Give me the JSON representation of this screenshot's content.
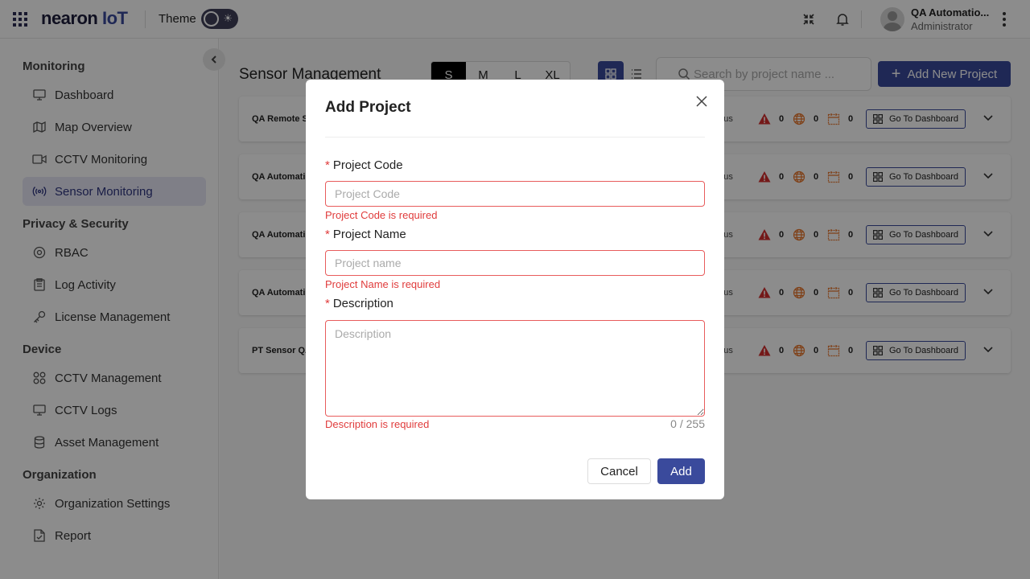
{
  "header": {
    "logo_main": "nearon",
    "logo_iot": "IoT",
    "theme_label": "Theme",
    "user_name": "QA Automatio...",
    "user_role": "Administrator"
  },
  "sidebar": {
    "sections": [
      {
        "title": "Monitoring",
        "items": [
          {
            "label": "Dashboard",
            "icon": "monitor-icon"
          },
          {
            "label": "Map Overview",
            "icon": "map-icon"
          },
          {
            "label": "CCTV Monitoring",
            "icon": "video-camera-icon"
          },
          {
            "label": "Sensor Monitoring",
            "icon": "broadcast-icon",
            "active": true
          }
        ]
      },
      {
        "title": "Privacy & Security",
        "items": [
          {
            "label": "RBAC",
            "icon": "at-sign-icon"
          },
          {
            "label": "Log Activity",
            "icon": "clipboard-icon"
          },
          {
            "label": "License Management",
            "icon": "key-icon"
          }
        ]
      },
      {
        "title": "Device",
        "items": [
          {
            "label": "CCTV Management",
            "icon": "apps-icon"
          },
          {
            "label": "CCTV Logs",
            "icon": "monitor-icon"
          },
          {
            "label": "Asset Management",
            "icon": "database-icon"
          }
        ]
      },
      {
        "title": "Organization",
        "items": [
          {
            "label": "Organization Settings",
            "icon": "gear-icon"
          },
          {
            "label": "Report",
            "icon": "document-icon"
          }
        ]
      }
    ]
  },
  "main": {
    "title": "Sensor Management",
    "sizes": [
      "S",
      "M",
      "L",
      "XL"
    ],
    "active_size": "S",
    "search_placeholder": "Search by project name ...",
    "add_new_label": "Add New Project",
    "cards": [
      {
        "name": "QA Remote S",
        "status": "tatus",
        "alerts": "0",
        "network": "0",
        "calendar": "0",
        "goto": "Go To Dashboard"
      },
      {
        "name": "QA Automati",
        "status": "tatus",
        "alerts": "0",
        "network": "0",
        "calendar": "0",
        "goto": "Go To Dashboard"
      },
      {
        "name": "QA Automati",
        "status": "tatus",
        "alerts": "0",
        "network": "0",
        "calendar": "0",
        "goto": "Go To Dashboard"
      },
      {
        "name": "QA Automati",
        "status": "tatus",
        "alerts": "0",
        "network": "0",
        "calendar": "0",
        "goto": "Go To Dashboard"
      },
      {
        "name": "PT Sensor QA",
        "status": "tatus",
        "alerts": "0",
        "network": "0",
        "calendar": "0",
        "goto": "Go To Dashboard"
      }
    ]
  },
  "modal": {
    "title": "Add Project",
    "required_mark": "*",
    "project_code": {
      "label": "Project Code",
      "placeholder": "Project Code",
      "value": "",
      "error": "Project Code is required"
    },
    "project_name": {
      "label": "Project Name",
      "placeholder": "Project name",
      "value": "",
      "error": "Project Name is required"
    },
    "description": {
      "label": "Description",
      "placeholder": "Description",
      "value": "",
      "error": "Description is required",
      "counter": "0 / 255"
    },
    "cancel_label": "Cancel",
    "add_label": "Add"
  },
  "colors": {
    "accent": "#3a4a9c",
    "error": "#e03c3c",
    "alert_red": "#d32f2f",
    "network_orange": "#e8752a"
  }
}
